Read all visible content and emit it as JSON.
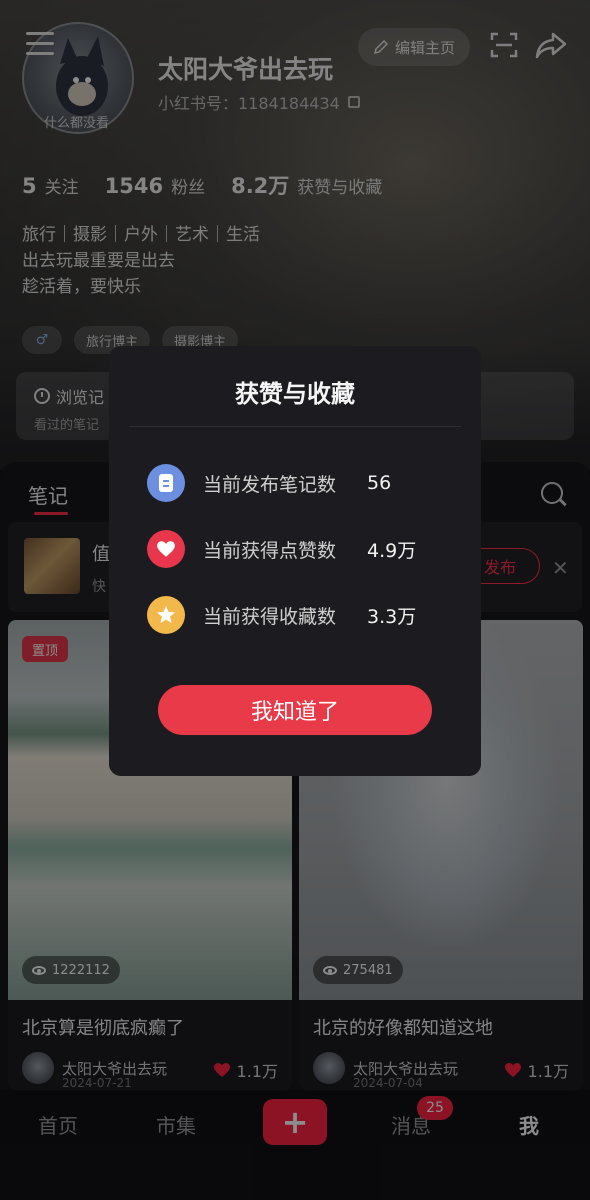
{
  "profile": {
    "username": "太阳大爷出去玩",
    "user_id": "小红书号：1184184434",
    "avatar_caption": "什么都没看",
    "edit_label": "编辑主页",
    "stats": [
      {
        "num": "5",
        "label": "关注"
      },
      {
        "num": "1546",
        "label": "粉丝"
      },
      {
        "num": "8.2万",
        "label": "获赞与收藏"
      }
    ],
    "bio_lines": [
      "旅行｜摄影｜户外｜艺术｜生活",
      "出去玩最重要是出去",
      "趁活着，要快乐"
    ],
    "tags": [
      "旅行博主",
      "摄影博主"
    ],
    "gender_symbol": "♂",
    "quick_card": {
      "title": "浏览记",
      "sub": "看过的笔记"
    }
  },
  "tabs": {
    "notes": "笔记"
  },
  "draft": {
    "title": "值",
    "sub": "快",
    "publish_label": "发布",
    "close_symbol": "✕"
  },
  "notes": [
    {
      "pin": "置顶",
      "views": "1222112",
      "title": "北京算是彻底疯癫了",
      "author": "太阳大爷出去玩",
      "date": "2024-07-21",
      "likes": "1.1万"
    },
    {
      "views": "275481",
      "title": "北京的好像都知道这地",
      "author": "太阳大爷出去玩",
      "date": "2024-07-04",
      "likes": "1.1万"
    }
  ],
  "bottom_nav": {
    "home": "首页",
    "market": "市集",
    "add_symbol": "+",
    "messages": "消息",
    "messages_badge": "25",
    "me": "我"
  },
  "modal": {
    "title": "获赞与收藏",
    "rows": [
      {
        "label": "当前发布笔记数",
        "value": "56",
        "icon": "note-icon",
        "color": "#6c8fe0"
      },
      {
        "label": "当前获得点赞数",
        "value": "4.9万",
        "icon": "heart-icon",
        "color": "#e8374c"
      },
      {
        "label": "当前获得收藏数",
        "value": "3.3万",
        "icon": "star-icon",
        "color": "#f2b84b"
      }
    ],
    "ok_label": "我知道了"
  },
  "colors": {
    "accent": "#ff2442",
    "modal_button": "#e83a48"
  }
}
